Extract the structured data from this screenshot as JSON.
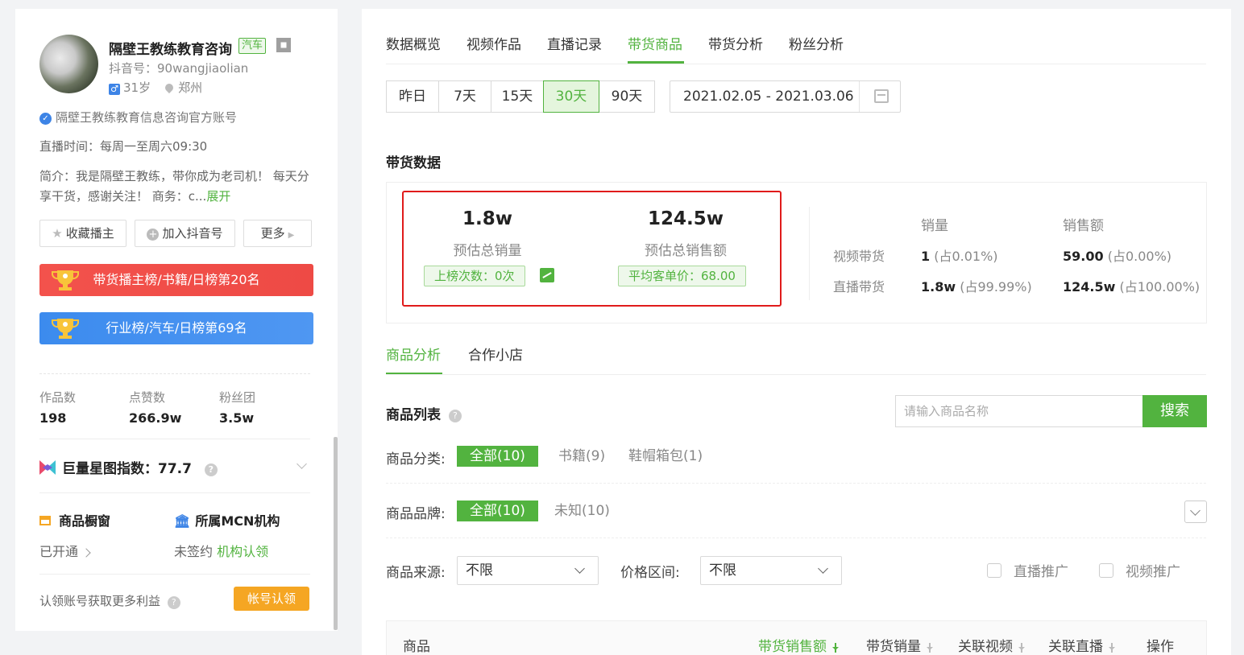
{
  "profile": {
    "name": "隔壁王教练教育咨询",
    "category_tag": "汽车",
    "douyin_id": "抖音号：90wangjiaolian",
    "age": "31岁",
    "city": "郑州",
    "verified_text": "隔壁王教练教育信息咨询官方账号",
    "live_time": "直播时间：每周一至周六09:30",
    "intro": "简介：我是隔壁王教练，带你成为老司机！ 每天分享干货，感谢关注！ 商务：c...",
    "expand_label": "展开",
    "buttons": {
      "favorite": "收藏播主",
      "add": "加入抖音号",
      "more": "更多"
    },
    "rank_goods": "带货播主榜/书籍/日榜第20名",
    "rank_industry": "行业榜/汽车/日榜第69名",
    "stats": [
      {
        "label": "作品数",
        "value": "198"
      },
      {
        "label": "点赞数",
        "value": "266.9w"
      },
      {
        "label": "粉丝团",
        "value": "3.5w"
      }
    ],
    "star_index_label": "巨量星图指数：",
    "star_index_value": "77.7",
    "shop_label": "商品橱窗",
    "shop_status": "已开通",
    "mcn_label": "所属MCN机构",
    "mcn_status": "未签约",
    "mcn_link": "机构认领",
    "claim_text": "认领账号获取更多利益",
    "claim_button": "帐号认领",
    "colors": {
      "green": "#52b33f",
      "red_bar": "#ef4d48",
      "blue_bar": "#3f8eef",
      "claim": "#f5a623"
    }
  },
  "tabs": [
    "数据概览",
    "视频作品",
    "直播记录",
    "带货商品",
    "带货分析",
    "粉丝分析"
  ],
  "active_tab": "带货商品",
  "ranges": [
    "昨日",
    "7天",
    "15天",
    "30天",
    "90天"
  ],
  "active_range": "30天",
  "date_range": "2021.02.05 - 2021.03.06",
  "goods_data": {
    "title": "带货数据",
    "total_sales": "1.8w",
    "total_sales_label": "预估总销量",
    "rank_count": "上榜次数：0次",
    "total_amount": "124.5w",
    "total_amount_label": "预估总销售额",
    "avg_price": "平均客单价：68.00",
    "col_sales": "销量",
    "col_amount": "销售额",
    "rows": [
      {
        "label": "视频带货",
        "sales": "1",
        "sales_pct": "(占0.01%)",
        "amount": "59.00",
        "amount_pct": "(占0.00%)"
      },
      {
        "label": "直播带货",
        "sales": "1.8w",
        "sales_pct": "(占99.99%)",
        "amount": "124.5w",
        "amount_pct": "(占100.00%)"
      }
    ]
  },
  "subtabs": [
    "商品分析",
    "合作小店"
  ],
  "list": {
    "title": "商品列表",
    "search_placeholder": "请输入商品名称",
    "search_button": "搜索",
    "category_label": "商品分类:",
    "categories": [
      "全部(10)",
      "书籍(9)",
      "鞋帽箱包(1)"
    ],
    "brand_label": "商品品牌:",
    "brands": [
      "全部(10)",
      "未知(10)"
    ],
    "source_label": "商品来源:",
    "source_value": "不限",
    "price_label": "价格区间:",
    "price_value": "不限",
    "checkbox_live": "直播推广",
    "checkbox_video": "视频推广",
    "columns": [
      "商品",
      "带货销售额",
      "带货销量",
      "关联视频",
      "关联直播",
      "操作"
    ]
  }
}
